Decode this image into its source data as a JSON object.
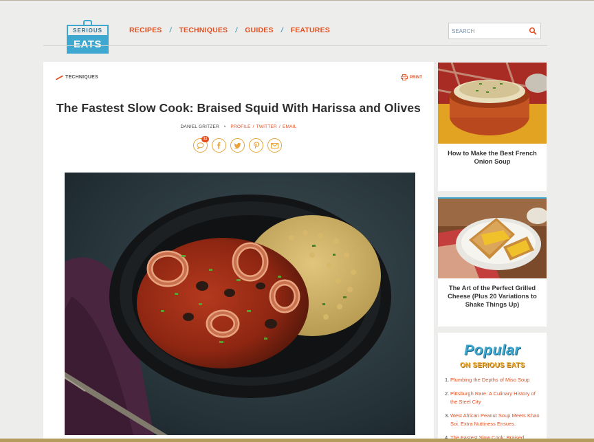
{
  "header": {
    "logo_top": "SERIOUS",
    "logo_bottom": "EATS",
    "nav": [
      "RECIPES",
      "TECHNIQUES",
      "GUIDES",
      "FEATURES"
    ],
    "search_placeholder": "SEARCH"
  },
  "article": {
    "category": "TECHNIQUES",
    "print_label": "PRINT",
    "title": "The Fastest Slow Cook: Braised Squid With Harissa and Olives",
    "author": "DANIEL GRITZER",
    "links": [
      "PROFILE",
      "TWITTER",
      "EMAIL"
    ],
    "comment_count": "11"
  },
  "sidebar": {
    "cards": [
      {
        "caption": "How to Make the Best French Onion Soup"
      },
      {
        "caption": "The Art of the Perfect Grilled Cheese (Plus 20 Variations to Shake Things Up)"
      }
    ],
    "popular": {
      "title": "Popular",
      "subtitle": "ON SERIOUS EATS",
      "items": [
        "Plumbing the Depths of Miso Soup",
        "Pittsburgh Rare: A Culinary History of the Steel City",
        "West African Peanut Soup Meets Khao Soi. Extra Nuttiness Ensues.",
        "The Fastest Slow Cook: Braised"
      ],
      "numbers": [
        "1.",
        "2.",
        "3.",
        "4."
      ]
    }
  },
  "colors": {
    "accent": "#e44e1f",
    "brand_blue": "#3ea8d0",
    "share_ring": "#e7a23a",
    "background": "#ededeb"
  }
}
